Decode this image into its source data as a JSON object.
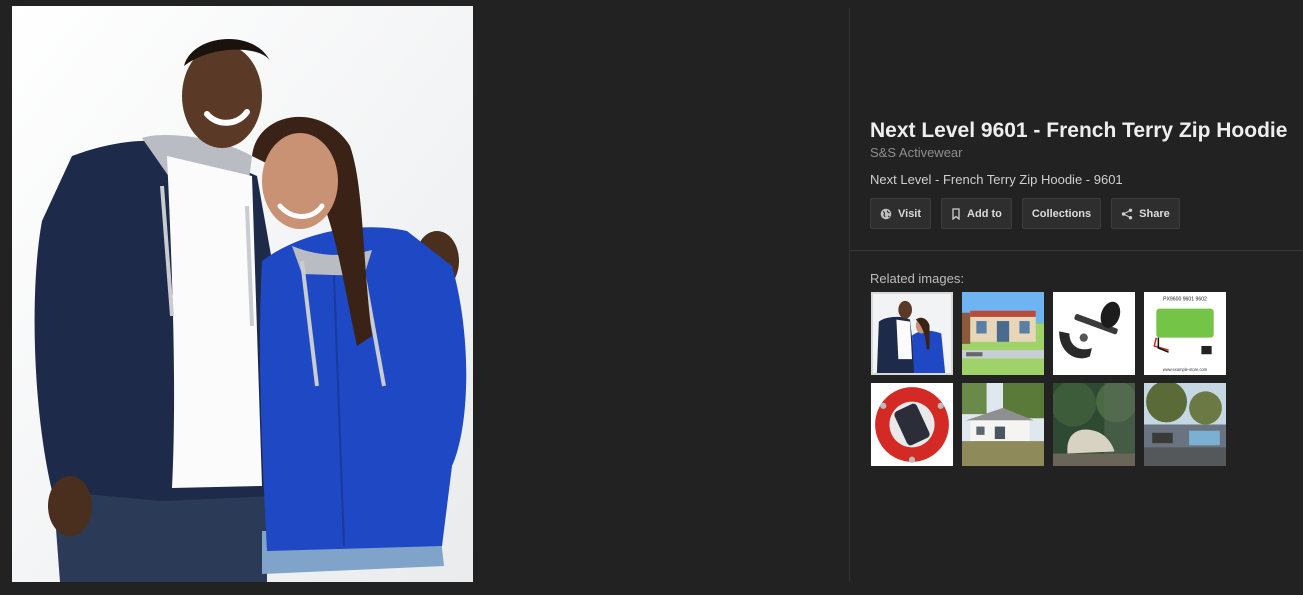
{
  "main_image": {
    "alt": "Next Level 9601 - French Terry Zip Hoodie"
  },
  "info": {
    "title": "Next Level 9601 - French Terry Zip Hoodie",
    "source": "S&S Activewear",
    "description": "Next Level - French Terry Zip Hoodie - 9601"
  },
  "actions": [
    {
      "label": "Visit",
      "icon": "globe-icon"
    },
    {
      "label": "Add to",
      "icon": "bookmark-icon"
    },
    {
      "label": "Collections",
      "icon": ""
    },
    {
      "label": "Share",
      "icon": "share-icon"
    }
  ],
  "related": {
    "label": "Related images:",
    "thumb_captions": {
      "battery_title": "PX9600 9601 9602",
      "battery_url": "www.example-store.com"
    }
  },
  "colors": {
    "background": "#222222",
    "hoodie_navy": "#1d2a4a",
    "hoodie_blue": "#1e48c4"
  }
}
